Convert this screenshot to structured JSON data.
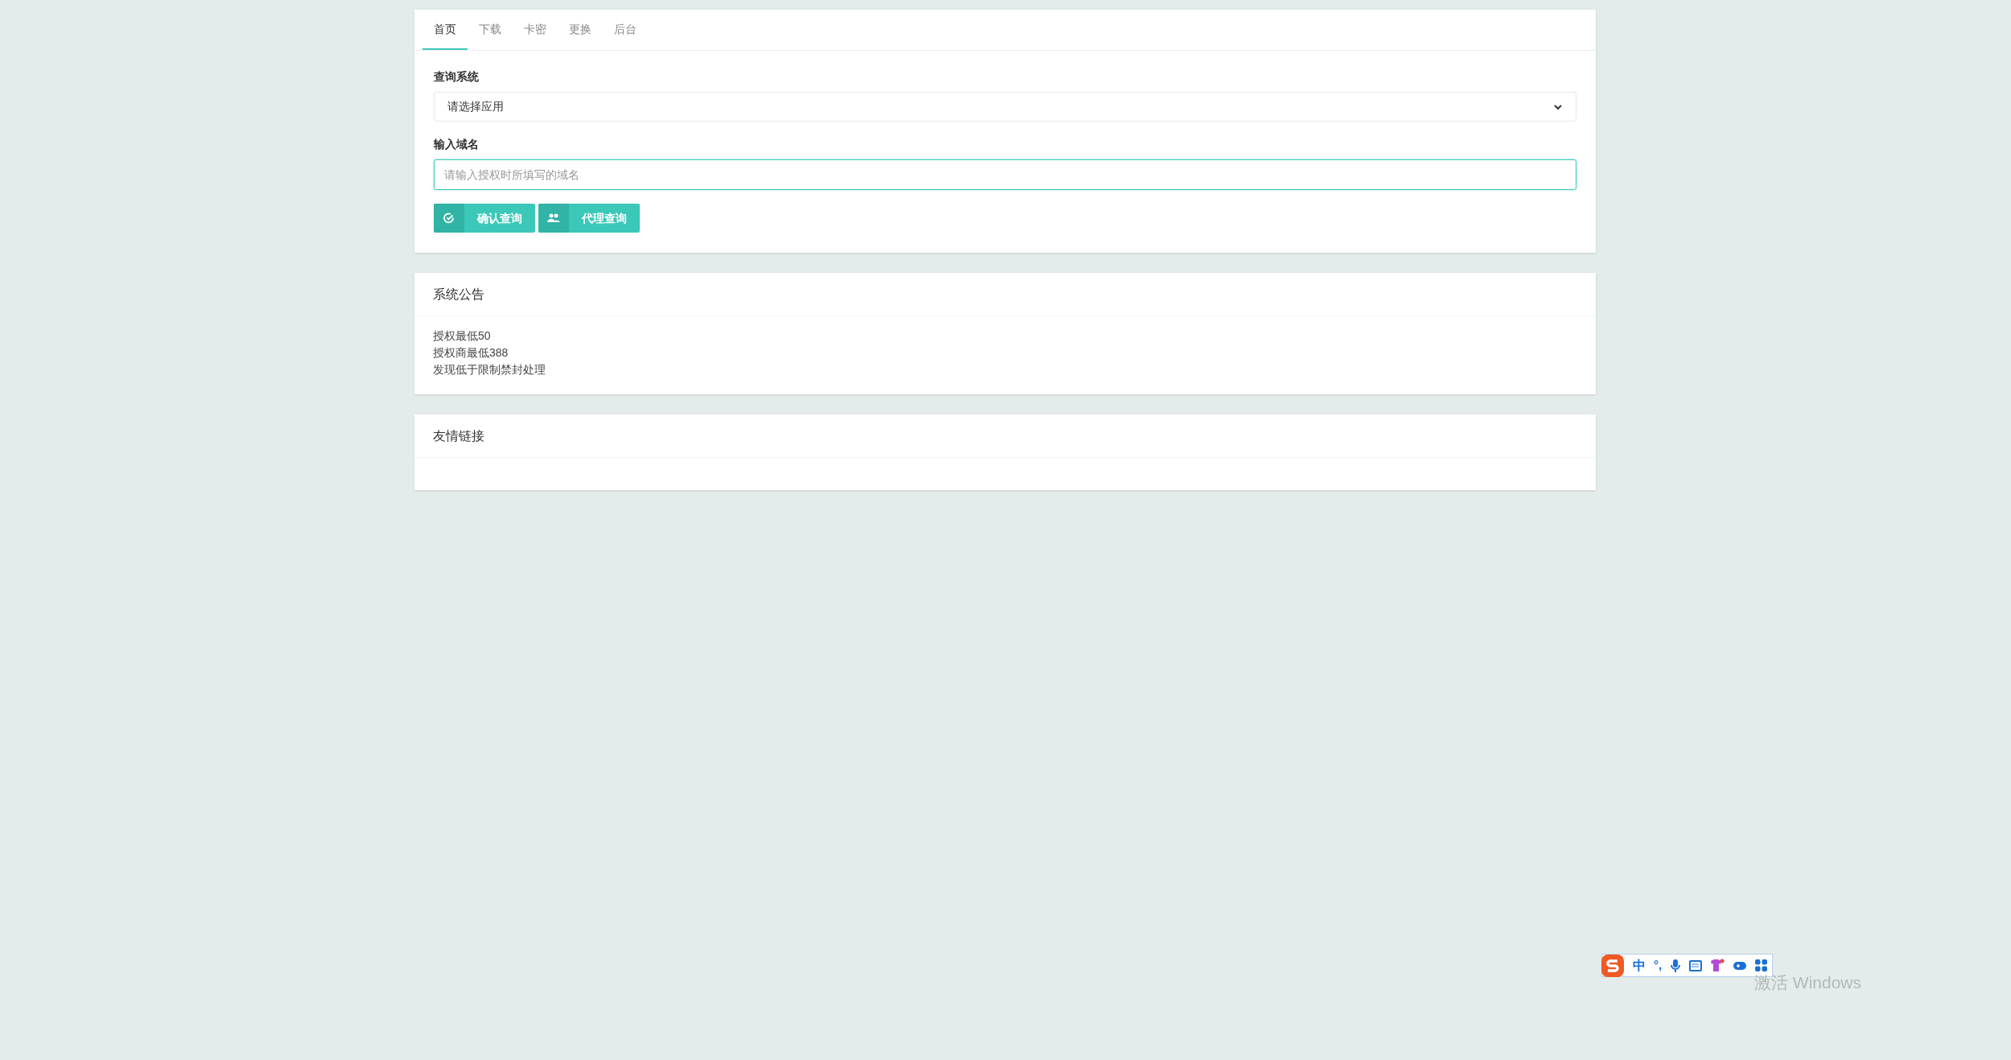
{
  "tabs": [
    {
      "label": "首页",
      "selected": true
    },
    {
      "label": "下载",
      "selected": false
    },
    {
      "label": "卡密",
      "selected": false
    },
    {
      "label": "更换",
      "selected": false
    },
    {
      "label": "后台",
      "selected": false
    }
  ],
  "query_form": {
    "system_label": "查询系统",
    "system_select": {
      "value": "请选择应用"
    },
    "domain_label": "输入域名",
    "domain_input": {
      "placeholder": "请输入授权时所填写的域名"
    },
    "buttons": [
      {
        "kind": "check",
        "label": "确认查询"
      },
      {
        "kind": "users",
        "label": "代理查询"
      }
    ]
  },
  "announcement": {
    "title": "系统公告",
    "lines": [
      "授权最低50",
      "授权商最低388",
      "发现低于限制禁封处理"
    ]
  },
  "friend_links": {
    "title": "友情链接"
  },
  "ime_toolbar": {
    "items": [
      "中",
      "°,"
    ]
  },
  "activation_notice": {
    "title": "激活 Windows"
  }
}
